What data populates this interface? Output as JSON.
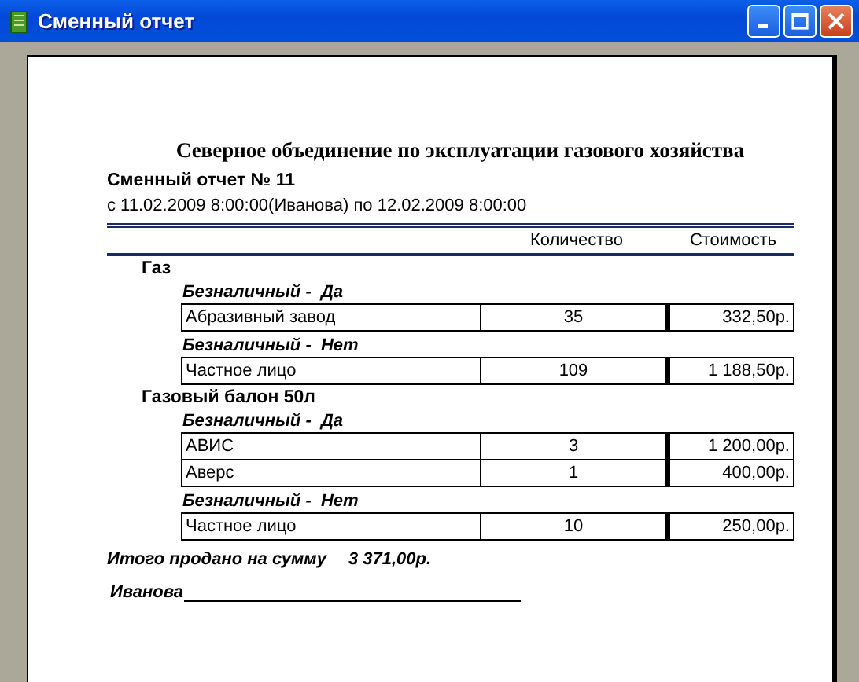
{
  "window": {
    "title": "Сменный отчет"
  },
  "report": {
    "organization": "Северное объединение по эксплуатации газового хозяйства",
    "title": "Сменный отчет № 11",
    "period": "с 11.02.2009 8:00:00(Иванова) по 12.02.2009 8:00:00",
    "columns": [
      "Количество",
      "Стоимость"
    ],
    "groups": [
      {
        "name": "Газ",
        "payment_groups": [
          {
            "label": "Безналичный -  Да",
            "rows": [
              {
                "name": "Абразивный завод",
                "quantity": "35",
                "cost": "332,50р."
              }
            ]
          },
          {
            "label": "Безналичный -  Нет",
            "rows": [
              {
                "name": "Частное лицо",
                "quantity": "109",
                "cost": "1 188,50р."
              }
            ]
          }
        ]
      },
      {
        "name": "Газовый балон 50л",
        "payment_groups": [
          {
            "label": "Безналичный -  Да",
            "rows": [
              {
                "name": "АВИС",
                "quantity": "3",
                "cost": "1 200,00р."
              },
              {
                "name": "Аверс",
                "quantity": "1",
                "cost": "400,00р."
              }
            ]
          },
          {
            "label": "Безналичный -  Нет",
            "rows": [
              {
                "name": "Частное лицо",
                "quantity": "10",
                "cost": "250,00р."
              }
            ]
          }
        ]
      }
    ],
    "total_label": "Итого продано на сумму",
    "total_value": "3 371,00р.",
    "signature_name": "Иванова"
  }
}
